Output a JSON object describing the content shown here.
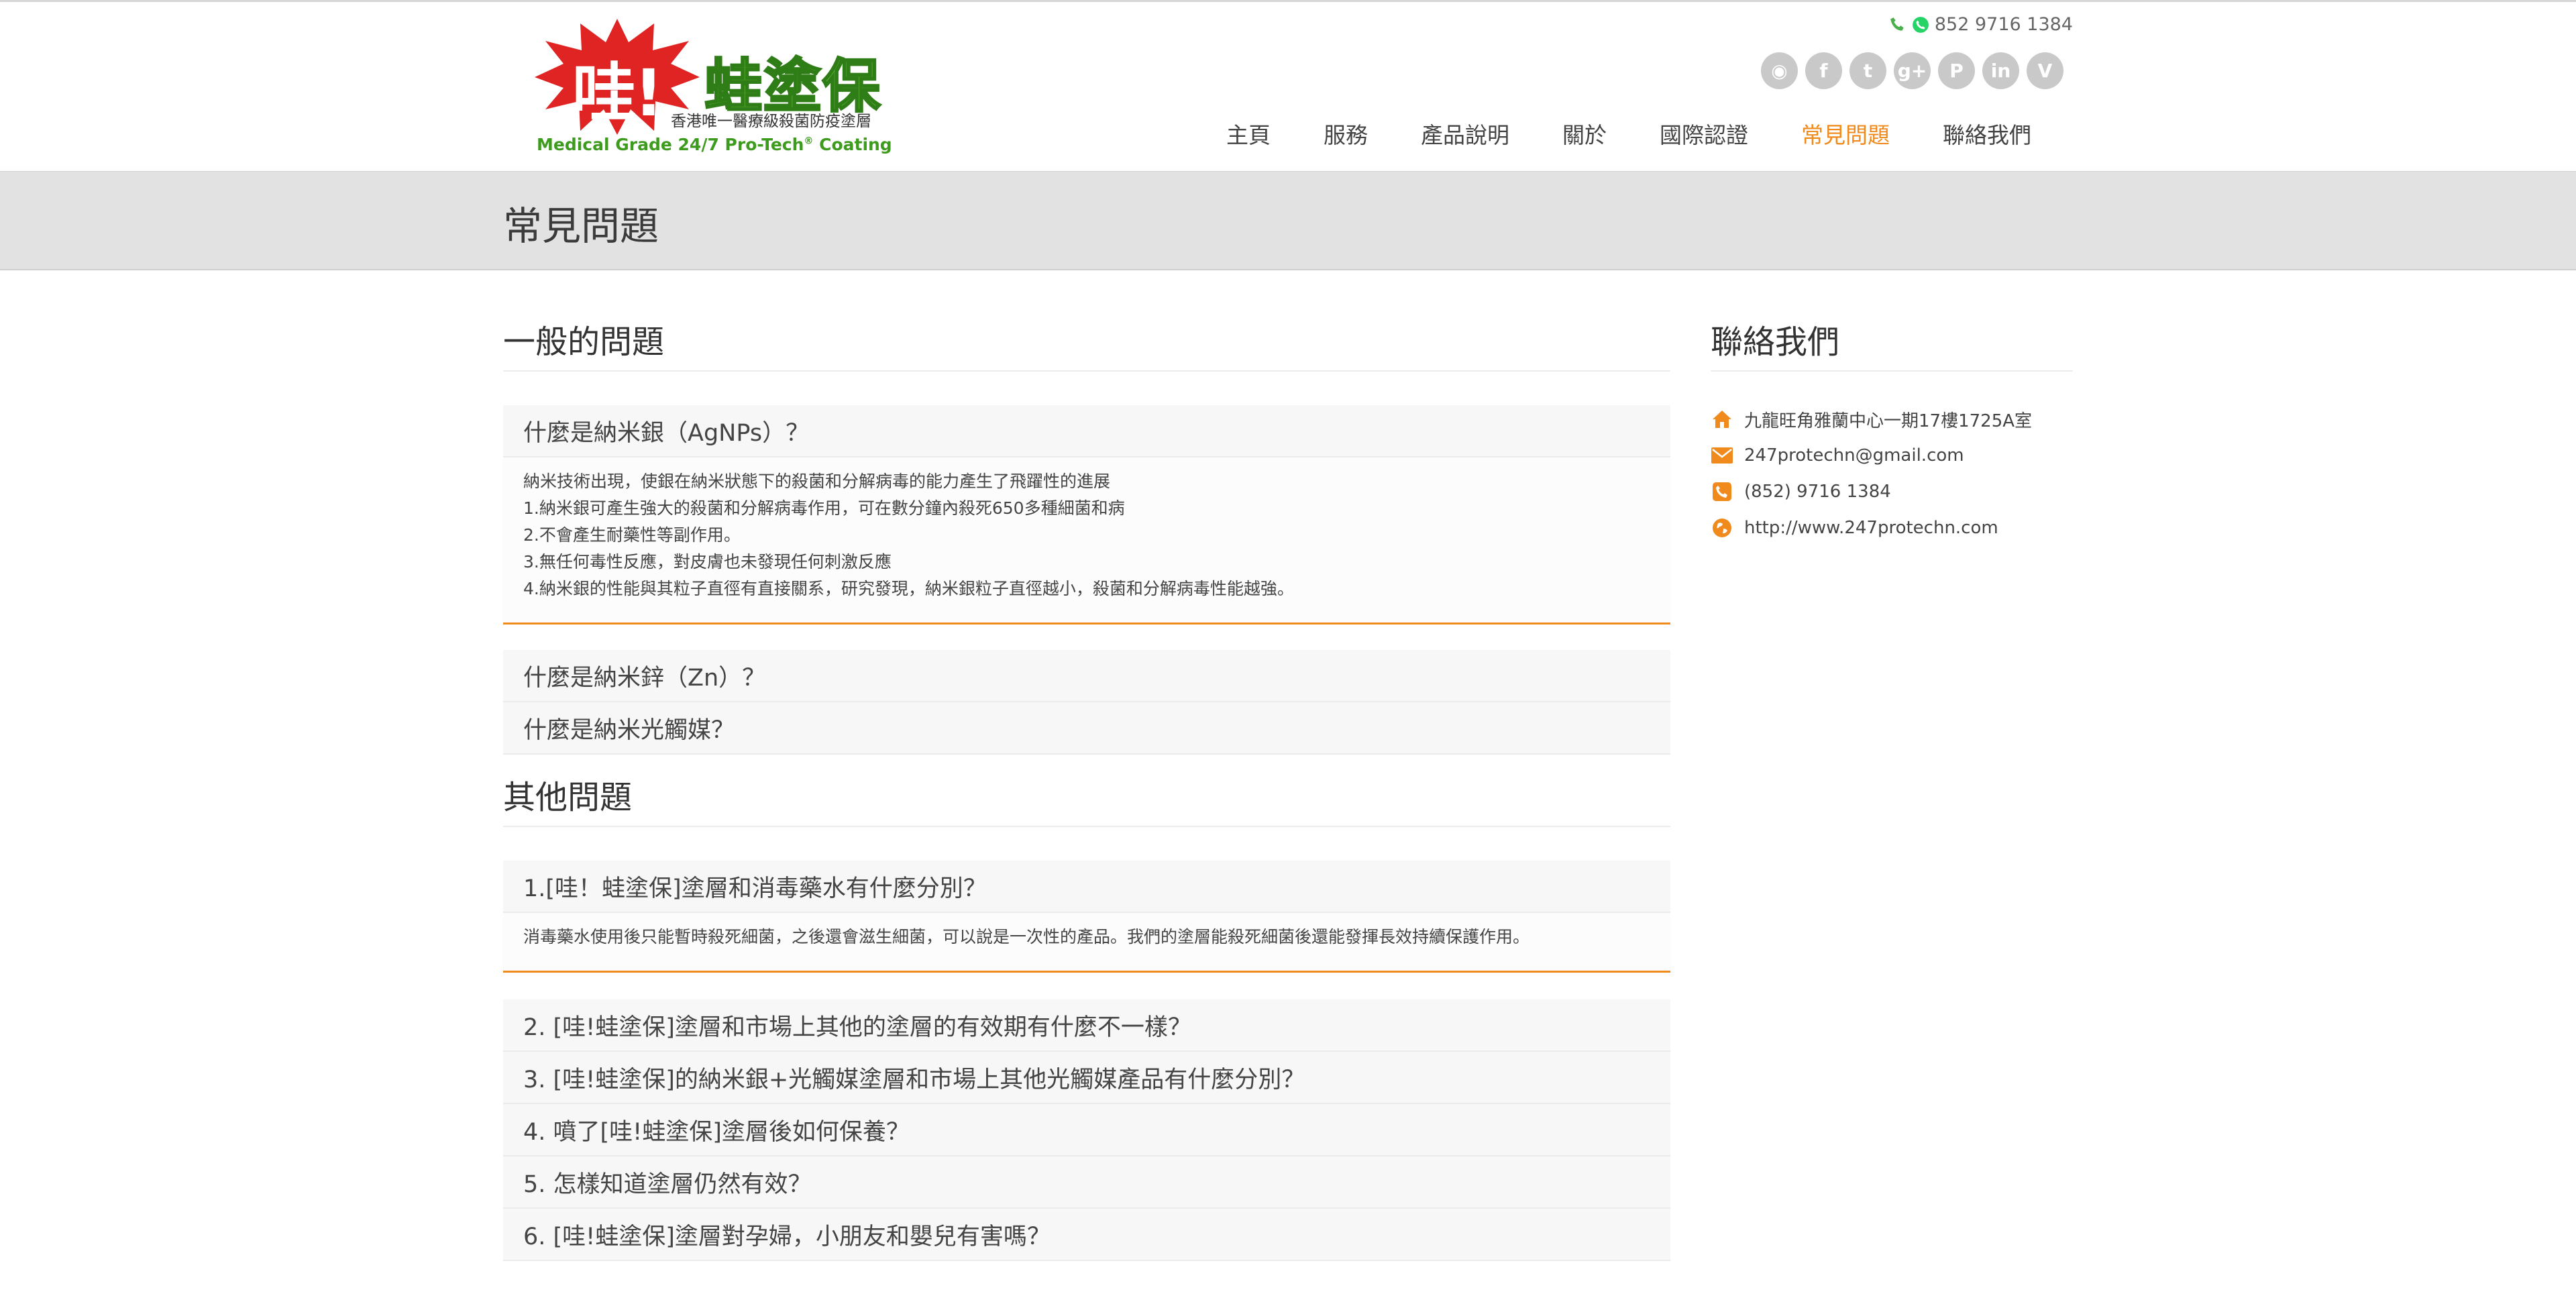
{
  "header": {
    "logo": {
      "burst_text": "哇!",
      "brand": "蛙塗保",
      "subtitle": "香港唯一醫療級殺菌防疫塗層",
      "tagline": "Medical Grade 24/7 Pro-Tech",
      "tagline_sup": "®",
      "tagline_end": " Coating"
    },
    "phone": "852 9716 1384",
    "social_icons": [
      "rss-icon",
      "facebook-icon",
      "twitter-icon",
      "google-plus-icon",
      "pinterest-icon",
      "linkedin-icon",
      "vimeo-icon"
    ],
    "social_glyphs": [
      "◉",
      "f",
      "t",
      "g+",
      "P",
      "in",
      "V"
    ],
    "nav": [
      "主頁",
      "服務",
      "產品說明",
      "關於",
      "國際認證",
      "常見問題",
      "聯絡我們"
    ],
    "nav_active_index": 5
  },
  "banner": {
    "title": "常見問題"
  },
  "main": {
    "general": {
      "heading": "一般的問題",
      "q1": "什麼是納米銀（AgNPs）？",
      "a1": [
        "納米技術出現，使銀在納米狀態下的殺菌和分解病毒的能力產生了飛躍性的進展",
        "1.納米銀可產生強大的殺菌和分解病毒作用，可在數分鐘內殺死650多種細菌和病",
        "2.不會產生耐藥性等副作用。",
        "3.無任何毒性反應，對皮膚也未發現任何刺激反應",
        "4.納米銀的性能與其粒子直徑有直接關系，研究發現，納米銀粒子直徑越小，殺菌和分解病毒性能越強。"
      ],
      "q2": "什麼是納米鋅（Zn）？",
      "q3": "什麼是納米光觸媒？"
    },
    "other": {
      "heading": "其他問題",
      "q1": "1.[哇！蛙塗保]塗層和消毒藥水有什麼分別？",
      "a1": "消毒藥水使用後只能暫時殺死細菌，之後還會滋生細菌，可以說是一次性的產品。我們的塗層能殺死細菌後還能發揮長效持續保護作用。",
      "q2": "2. [哇!蛙塗保]塗層和市場上其他的塗層的有效期有什麼不一樣？",
      "q3": "3. [哇!蛙塗保]的納米銀+光觸媒塗層和市場上其他光觸媒產品有什麼分別？",
      "q4": "4. 噴了[哇!蛙塗保]塗層後如何保養？",
      "q5": "5. 怎樣知道塗層仍然有效？",
      "q6": "6. [哇!蛙塗保]塗層對孕婦，小朋友和嬰兒有害嗎？"
    }
  },
  "sidebar": {
    "heading": "聯絡我們",
    "address": "九龍旺角雅蘭中心一期17樓1725A室",
    "email": "247protechn@gmail.com",
    "phone": "(852) 9716 1384",
    "website": "http://www.247protechn.com"
  },
  "colors": {
    "accent": "#f08a1c",
    "brand_green": "#5cb531",
    "logo_red": "#e02424"
  }
}
